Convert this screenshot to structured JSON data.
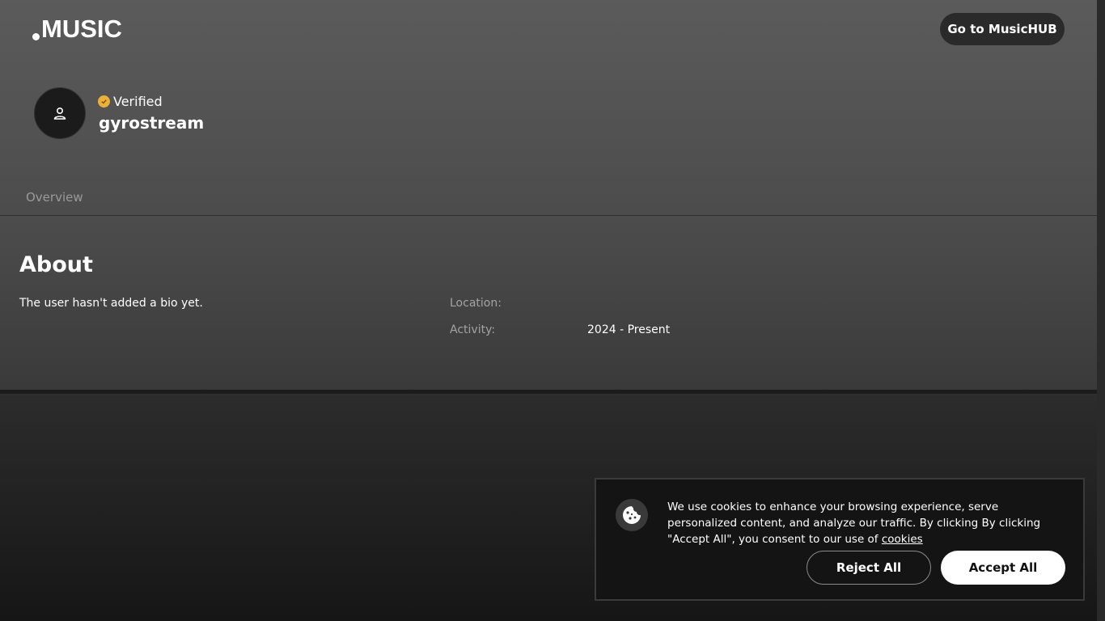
{
  "header": {
    "logo_text": "MUSIC",
    "hub_button_label": "Go to MusicHUB"
  },
  "profile": {
    "avatar_icon": "user-icon",
    "verified_icon": "verified-badge-icon",
    "verified_label": "Verified",
    "username": "gyrostream",
    "badge_color": "#e9b03a"
  },
  "tabs": [
    {
      "label": "Overview"
    }
  ],
  "about": {
    "title": "About",
    "bio": "The user hasn't added a bio yet.",
    "location_label": "Location:",
    "location_value": "",
    "activity_label": "Activity:",
    "activity_value": "2024 - Present"
  },
  "cookie_banner": {
    "icon": "cookie-icon",
    "text": "We use cookies to enhance your browsing experience, serve personalized content, and analyze our traffic. By clicking By clicking \"Accept All\", you consent to our use of",
    "link_text": "cookies",
    "reject_label": "Reject All",
    "accept_label": "Accept All"
  }
}
